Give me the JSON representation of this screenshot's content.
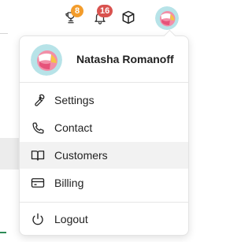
{
  "topbar": {
    "trophy_badge": "8",
    "bell_badge": "16",
    "badge_colors": {
      "trophy": "#f39c2b",
      "bell": "#d9534f"
    }
  },
  "user": {
    "name": "Natasha Romanoff"
  },
  "menu": {
    "items": [
      {
        "label": "Settings",
        "icon": "wrench-icon"
      },
      {
        "label": "Contact",
        "icon": "phone-icon"
      },
      {
        "label": "Customers",
        "icon": "book-icon",
        "active": true
      },
      {
        "label": "Billing",
        "icon": "credit-card-icon"
      }
    ],
    "logout": {
      "label": "Logout",
      "icon": "power-icon"
    }
  }
}
